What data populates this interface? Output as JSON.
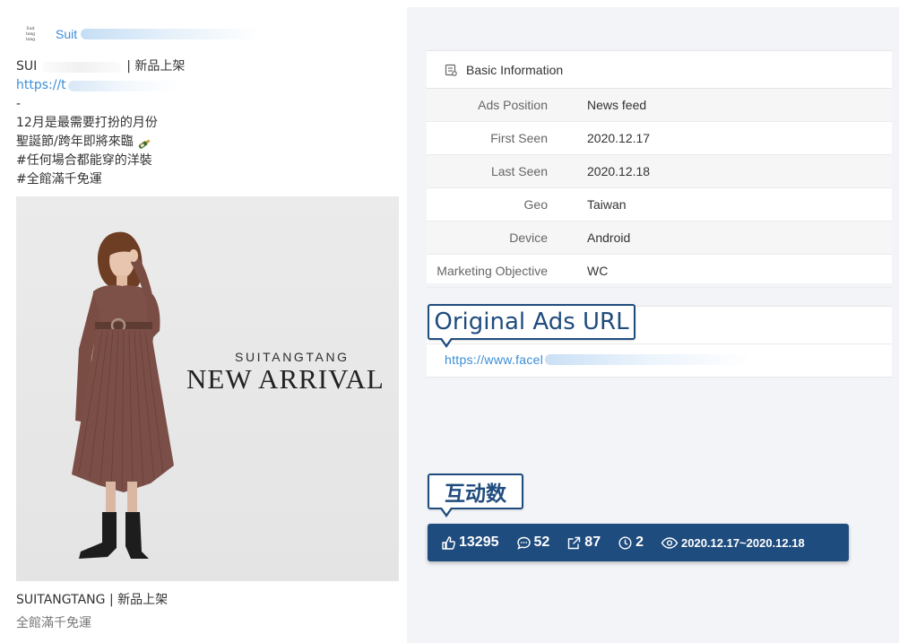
{
  "post": {
    "page_name": "Suit",
    "logo_text": "SUITANGTANG",
    "line_1_start": "SUI",
    "line_1_end": "| 新品上架",
    "url_prefix": "https://t",
    "dash": "-",
    "line_month": "12月是最需要打扮的月份",
    "line_holiday": "聖誕節/跨年即將來臨",
    "line_tag_1": "#任何場合都能穿的洋裝",
    "line_tag_2": "#全館滿千免運",
    "image_brand": "SUITANGTANG",
    "image_headline": "NEW ARRIVAL",
    "caption_title": "SUITANGTANG | 新品上架",
    "caption_sub": "全館滿千免運",
    "icons": {
      "holiday": "champagne-bottle-icon"
    }
  },
  "basic_info": {
    "title": "Basic Information",
    "rows": [
      {
        "label": "Ads Position",
        "value": "News feed"
      },
      {
        "label": "First Seen",
        "value": "2020.12.17"
      },
      {
        "label": "Last Seen",
        "value": "2020.12.18"
      },
      {
        "label": "Geo",
        "value": "Taiwan"
      },
      {
        "label": "Device",
        "value": "Android"
      },
      {
        "label": "Marketing Objective",
        "value": "WC"
      }
    ]
  },
  "ads_url": {
    "callout": "Original Ads URL",
    "url": "https://www.facel"
  },
  "interaction": {
    "callout": "互动数",
    "likes": "13295",
    "comments": "52",
    "shares": "87",
    "duration": "2",
    "date_range": "2020.12.17~2020.12.18"
  },
  "colors": {
    "accent": "#1f4c7e",
    "link": "#3b8ed6",
    "panel_bg": "#f2f4f7"
  }
}
